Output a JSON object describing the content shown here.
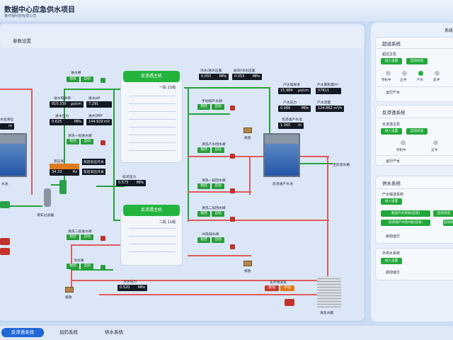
{
  "header": {
    "title": "数据中心应急供水项目",
    "subtitle": "某环保科技有限公司"
  },
  "params_title": "参数设置",
  "right_panel": {
    "title": "系统",
    "uf": {
      "title": "超滤系统",
      "host": "超滤主机",
      "btn_enter": "进入设置",
      "btn_auto": "自动状态",
      "states": [
        "停机中",
        "正冲",
        "产水",
        "反冲"
      ],
      "run_label": "运行产水"
    },
    "ro": {
      "title": "反渗透系统",
      "host": "反渗透主机",
      "btn_enter": "进入设置",
      "btn_auto": "自动状态",
      "states": [
        "停机中",
        "正冲"
      ],
      "run_label": "运行产水"
    },
    "supply": {
      "title": "供水系统",
      "sub": "产水输送系统",
      "btn_enter": "进入设置",
      "btn_backflush": "超滤产水泵组(自动)",
      "btn_auto": "自动状态",
      "btn_ro_pump": "反渗透产水泵A组(自动)",
      "start_label": "启动运行"
    },
    "ext": {
      "title": "外供水系统",
      "btn_enter": "进入设置",
      "start_label": "启动运行"
    }
  },
  "process": {
    "ro_main_1": {
      "title": "反渗透主机",
      "stage": "一段 21组"
    },
    "ro_main_2": {
      "title": "反渗透主机",
      "stage": "二段 11组"
    },
    "inlet_valve": {
      "label": "进水阀",
      "mode1": "程控",
      "mode2": "自动"
    },
    "inlet_cond": {
      "label": "进水电导率",
      "value": "910.330",
      "unit": "μs/cm"
    },
    "inlet_ph": {
      "label": "进水pH",
      "value": "7.291"
    },
    "inlet_pressure": {
      "label": "进水压力",
      "value": "0.625",
      "unit": "MPa"
    },
    "inlet_orp": {
      "label": "进水ORP",
      "value": "144.929",
      "unit": "mV"
    },
    "stage1_flush_valve": {
      "label": "清洗一段进水阀",
      "mode1": "程控",
      "mode2": "自动"
    },
    "high_pressure": {
      "label": "高压泵",
      "value": "34.33",
      "unit": "Hz"
    },
    "hp_low_switch": {
      "label": "泵前低压开关"
    },
    "hp_high_switch": {
      "label": "泵后高压开关"
    },
    "stage_pressure": {
      "label": "段间压力",
      "value": "0.573",
      "unit": "MPa"
    },
    "security_filter": "保安过滤器",
    "left_pool_label": "水池",
    "left_level": "水池液位",
    "left_level_unit": "m",
    "concentrate_pressure": {
      "label": "浓水/进水压差",
      "value": "0.055",
      "unit": "MPa"
    },
    "stage_diff": {
      "label": "段间/浓水压差",
      "value": "0.053",
      "unit": "MPa"
    },
    "manual_valve": {
      "label": "手动排产水阀",
      "mode1": "程控",
      "mode2": "自动"
    },
    "drain": "排放",
    "product_cond": {
      "label": "产水电导率",
      "value": "15.984",
      "unit": "μs/cm"
    },
    "product_total": {
      "label": "产水累积量m³",
      "value": "57811"
    },
    "product_pressure": {
      "label": "产水压力",
      "value": "0.066",
      "unit": "MPa"
    },
    "product_flow": {
      "label": "产水流量",
      "value": "124.862",
      "unit": "m³/h"
    },
    "ro_level": {
      "label": "反渗透产水池",
      "value": "1.560",
      "unit": "m"
    },
    "flush_product_valve": {
      "label": "清洗产水回水阀",
      "mode1": "程控",
      "mode2": "自动"
    },
    "flush_stage1_valve": {
      "label": "清洗一段回水阀",
      "mode1": "程控",
      "mode2": "自动"
    },
    "flush_stage2_valve": {
      "label": "清洗二段回水阀",
      "mode1": "程控",
      "mode2": "自动"
    },
    "flush_stage2_in": {
      "label": "清洗二段进水阀",
      "mode1": "程控",
      "mode2": "自动"
    },
    "conc_valve": {
      "label": "浓水阀",
      "mode1": "程控",
      "mode2": "自动"
    },
    "conc_pressure": {
      "label": "浓水压力",
      "value": "0.520",
      "unit": "MPa"
    },
    "flush_water_valve": {
      "label": "冲洗排水阀",
      "mode1": "程控",
      "mode2": "自动"
    },
    "chem_pump": {
      "label": "化学清洗泵",
      "mode1": "就地",
      "mode2": "手动"
    },
    "ro_pool": "反渗透产水池",
    "to_ro": "至反渗水箱",
    "clean_tank": "清洗水箱"
  },
  "tabs": [
    "反渗透系统",
    "加药系统",
    "供水系统"
  ],
  "colors": {
    "accent": "#1f68d6",
    "green": "#24b43e",
    "pipe_red": "#e05a5a"
  }
}
